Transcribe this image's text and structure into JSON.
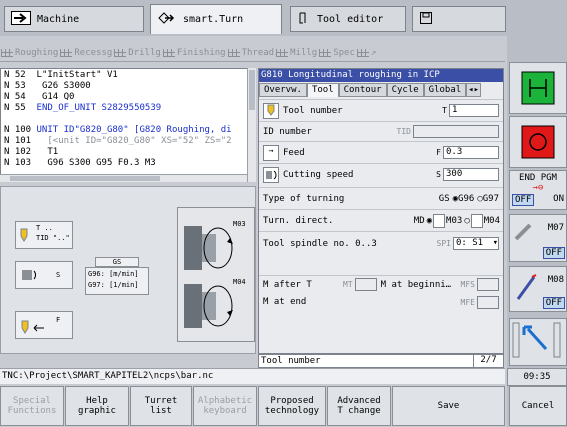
{
  "top_tabs": [
    {
      "label": "Machine",
      "icon": "arrow-right-icon"
    },
    {
      "label": "smart.Turn",
      "icon": "diamond-arrow-icon"
    },
    {
      "label": "Tool editor",
      "icon": "tool-editor-icon"
    },
    {
      "label": "",
      "icon": "save-disk-icon"
    }
  ],
  "unit_toolbar": [
    "Roughing",
    "Recessg",
    "Drillg",
    "Finishing",
    "Thread",
    "Millg",
    "Spec"
  ],
  "code_lines": [
    {
      "n": "N  52",
      "t": "L\"InitStart\" V1",
      "c": ""
    },
    {
      "n": "N  53",
      "t": "G26 S3000",
      "c": ""
    },
    {
      "n": "N  54",
      "t": "G14 Q0",
      "c": ""
    },
    {
      "n": "N  55",
      "t": "END_OF_UNIT S2829550539",
      "c": "blue"
    },
    {
      "n": "",
      "t": "",
      "c": ""
    },
    {
      "n": "N 100",
      "t": "UNIT ID\"G820_G80\" [G820 Roughing, di",
      "c": "blue"
    },
    {
      "n": "N 101",
      "t": "[<unit ID=\"G820_G80\" XS=\"52\" ZS=\"2",
      "c": "gray"
    },
    {
      "n": "N 102",
      "t": "T1",
      "c": ""
    },
    {
      "n": "N 103",
      "t": "G96 S300 G95 F0.3 M3",
      "c": ""
    }
  ],
  "graphic": {
    "t_label": "T ..",
    "tid_label": "TID \"..\"",
    "s_label": "S",
    "gs_label": "GS",
    "g96": "G96: [m/min]",
    "g97": "G97: [1/min]",
    "f_label": "F",
    "md_label": "MD",
    "m03": "M03",
    "m04": "M04"
  },
  "form": {
    "title": "G810 Longitudinal roughing in ICP",
    "tabs": [
      "Overvw.",
      "Tool",
      "Contour",
      "Cycle",
      "Global"
    ],
    "tool_number_label": "Tool number",
    "tool_number_key": "T",
    "tool_number_value": "1",
    "id_label": "ID number",
    "id_key": "TID",
    "id_value": "",
    "feed_label": "Feed",
    "feed_key": "F",
    "feed_value": "0.3",
    "speed_label": "Cutting speed",
    "speed_key": "S",
    "speed_value": "300",
    "turning_label": "Type of turning",
    "turning_key": "GS",
    "g96": "G96",
    "g97": "G97",
    "direction_label": "Turn. direct.",
    "direction_key": "MD",
    "m03": "M03",
    "m04": "M04",
    "spindle_label": "Tool spindle no. 0..3",
    "spindle_key": "SPI",
    "spindle_value": "0: S1",
    "m_after_t_label": "M after T",
    "m_after_t_key": "MT",
    "m_at_begin_label": "M at beginni…",
    "m_at_begin_key": "MFS",
    "m_at_end_label": "M at end",
    "m_at_end_key": "MFE"
  },
  "status": {
    "field": "Tool number",
    "page": "2/7"
  },
  "path": "TNC:\\Project\\SMART_KAPITEL2\\ncps\\bar.nc",
  "time": "09:35",
  "bottom_softkeys": [
    {
      "line1": "Special",
      "line2": "Functions",
      "enabled": false
    },
    {
      "line1": "Help",
      "line2": "graphic",
      "enabled": true
    },
    {
      "line1": "Turret",
      "line2": "list",
      "enabled": true
    },
    {
      "line1": "Alphabetic",
      "line2": "keyboard",
      "enabled": false
    },
    {
      "line1": "Proposed",
      "line2": "technology",
      "enabled": true
    },
    {
      "line1": "Advanced",
      "line2": "T change",
      "enabled": true
    },
    {
      "line1": "Save",
      "line2": "",
      "enabled": true
    },
    {
      "line1": "Cancel",
      "line2": "",
      "enabled": true
    }
  ],
  "right_keys": {
    "end_pgm": "END PGM",
    "off1": "OFF",
    "on1": "ON",
    "m07": "M07",
    "off2": "OFF",
    "m08": "M08",
    "off3": "OFF"
  },
  "colors": {
    "title_bar": "#3b4fa6",
    "code_blue": "#1a2fd0",
    "green": "#1bb33a",
    "red": "#e01818"
  }
}
